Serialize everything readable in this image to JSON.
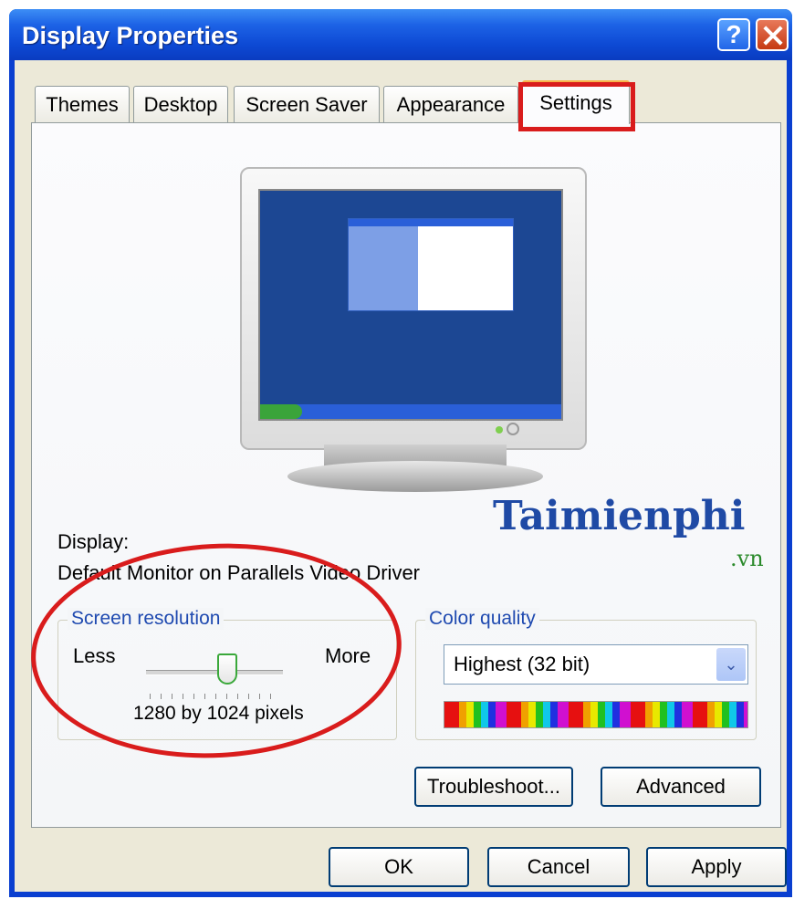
{
  "window": {
    "title": "Display Properties",
    "help_glyph": "?"
  },
  "tabs": [
    "Themes",
    "Desktop",
    "Screen Saver",
    "Appearance",
    "Settings"
  ],
  "active_tab": "Settings",
  "display": {
    "label": "Display:",
    "device": "Default Monitor on Parallels Video Driver"
  },
  "watermark": {
    "brand": "Taimienphi",
    "suffix": ".vn"
  },
  "screen_resolution": {
    "label": "Screen resolution",
    "less": "Less",
    "more": "More",
    "value_text": "1280 by 1024 pixels",
    "slider_level": 0.6
  },
  "color_quality": {
    "label": "Color quality",
    "selected": "Highest (32 bit)"
  },
  "buttons": {
    "troubleshoot": "Troubleshoot...",
    "advanced": "Advanced",
    "ok": "OK",
    "cancel": "Cancel",
    "apply": "Apply"
  },
  "colors": {
    "title_bar": "#0d49d4",
    "annotation_red": "#d91c1c",
    "group_label": "#1f4ab0"
  }
}
